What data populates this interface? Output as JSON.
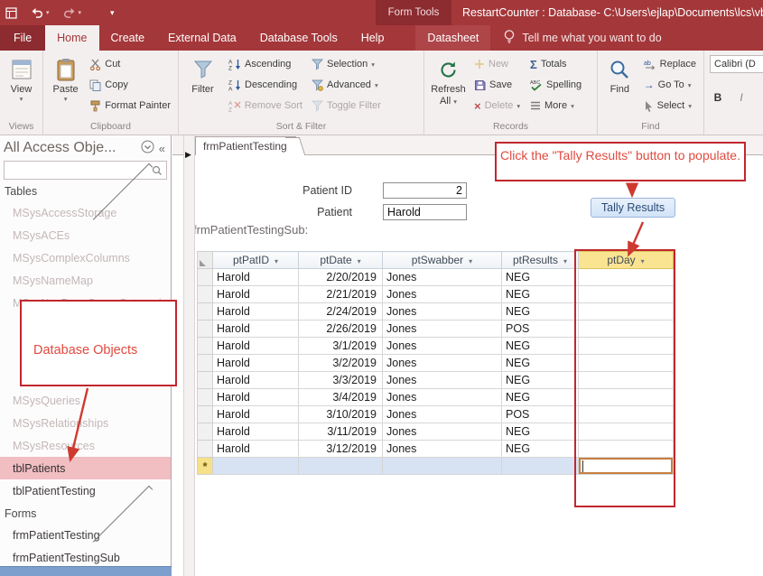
{
  "app": {
    "accent_color": "#A4373A",
    "annotation_color": "#C1272D",
    "title": "RestartCounter : Database- C:\\Users\\ejlap\\Documents\\lcs\\vbah",
    "context_group": "Form Tools"
  },
  "icons": {
    "dropdown": "▾",
    "collapse_double": "«",
    "record_arrow": "▶",
    "sigma": "Σ",
    "delete_x": "×",
    "goto_arrow": "→"
  },
  "tabs": {
    "file": "File",
    "items": [
      "Home",
      "Create",
      "External Data",
      "Database Tools",
      "Help"
    ],
    "contextual": "Datasheet",
    "active": "Home",
    "tellme": "Tell me what you want to do"
  },
  "ribbon": {
    "views": {
      "big": "View",
      "label": "Views"
    },
    "clipboard": {
      "big": "Paste",
      "cut": "Cut",
      "copy": "Copy",
      "format_painter": "Format Painter",
      "label": "Clipboard"
    },
    "sort_filter": {
      "big": "Filter",
      "ascending": "Ascending",
      "descending": "Descending",
      "remove_sort": "Remove Sort",
      "selection": "Selection",
      "advanced": "Advanced",
      "toggle_filter": "Toggle Filter",
      "label": "Sort & Filter"
    },
    "records": {
      "big_line1": "Refresh",
      "big_line2": "All",
      "new": "New",
      "save": "Save",
      "delete": "Delete",
      "totals": "Totals",
      "spelling": "Spelling",
      "more": "More",
      "label": "Records"
    },
    "find": {
      "big": "Find",
      "replace": "Replace",
      "goto": "Go To",
      "select": "Select",
      "label": "Find"
    },
    "text_formatting": {
      "font_name": "Calibri (D",
      "bold": "B",
      "italic": "I"
    }
  },
  "nav": {
    "title": "All Access Obje...",
    "groups": [
      {
        "label": "Tables"
      },
      {
        "label": "Forms"
      }
    ],
    "tables": [
      "MSysAccessStorage",
      "MSysACEs",
      "MSysComplexColumns",
      "MSysNameMap",
      "MSysNavPaneGroupCategories",
      "MSysQueries",
      "MSysRelationships",
      "MSysResources",
      "tblPatients",
      "tblPatientTesting"
    ],
    "forms": [
      "frmPatientTesting",
      "frmPatientTestingSub"
    ]
  },
  "form": {
    "doc_tab": "frmPatientTesting",
    "patient_id_label": "Patient ID",
    "patient_id_value": "2",
    "patient_label": "Patient",
    "patient_value": "Harold",
    "tally_button": "Tally Results",
    "subform_caption": "frmPatientTestingSub:"
  },
  "datasheet": {
    "columns": [
      "ptPatID",
      "ptDate",
      "ptSwabber",
      "ptResults",
      "ptDay"
    ],
    "rows": [
      [
        "Harold",
        "2/20/2019",
        "Jones",
        "NEG",
        ""
      ],
      [
        "Harold",
        "2/21/2019",
        "Jones",
        "NEG",
        ""
      ],
      [
        "Harold",
        "2/24/2019",
        "Jones",
        "NEG",
        ""
      ],
      [
        "Harold",
        "2/26/2019",
        "Jones",
        "POS",
        ""
      ],
      [
        "Harold",
        "3/1/2019",
        "Jones",
        "NEG",
        ""
      ],
      [
        "Harold",
        "3/2/2019",
        "Jones",
        "NEG",
        ""
      ],
      [
        "Harold",
        "3/3/2019",
        "Jones",
        "NEG",
        ""
      ],
      [
        "Harold",
        "3/4/2019",
        "Jones",
        "NEG",
        ""
      ],
      [
        "Harold",
        "3/10/2019",
        "Jones",
        "POS",
        ""
      ],
      [
        "Harold",
        "3/11/2019",
        "Jones",
        "NEG",
        ""
      ],
      [
        "Harold",
        "3/12/2019",
        "Jones",
        "NEG",
        ""
      ]
    ],
    "new_row_marker": "*"
  },
  "annotations": {
    "nav_callout": "Database Objects",
    "tally_callout": "Click the \"Tally Results\" button to populate."
  }
}
